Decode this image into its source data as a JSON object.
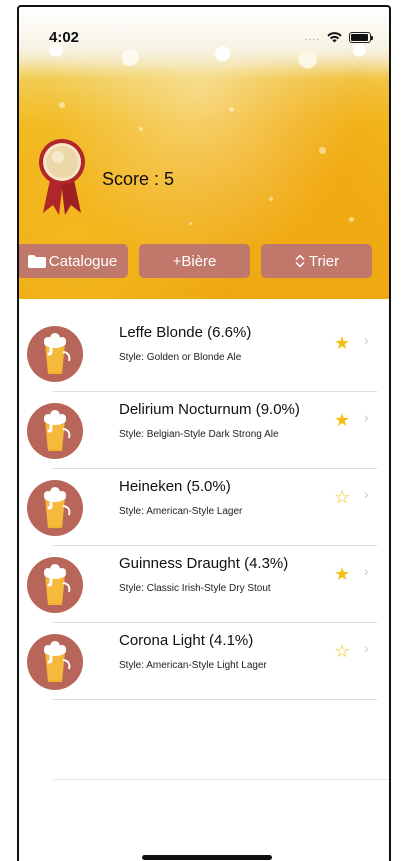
{
  "status_bar": {
    "time": "4:02",
    "signal_dots": "....",
    "wifi_icon": "wifi-icon",
    "battery_icon": "battery-icon"
  },
  "header": {
    "medal_icon": "medal-ribbon-icon",
    "score_text": "Score : 5"
  },
  "toolbar": {
    "catalogue_label": "Catalogue",
    "add_beer_label": "+Bière",
    "sort_label": "Trier"
  },
  "colors": {
    "button_bg": "#c0786a",
    "avatar_bg": "#b9665a",
    "star": "#f5bf12",
    "beer_amber": "#f0ae17"
  },
  "beers": [
    {
      "name": "Leffe Blonde (6.6%)",
      "style": "Style: Golden or Blonde Ale",
      "favorite": true
    },
    {
      "name": "Delirium Nocturnum (9.0%)",
      "style": "Style: Belgian-Style Dark Strong Ale",
      "favorite": true
    },
    {
      "name": "Heineken (5.0%)",
      "style": "Style: American-Style Lager",
      "favorite": false
    },
    {
      "name": "Guinness Draught (4.3%)",
      "style": "Style: Classic Irish-Style Dry Stout",
      "favorite": true
    },
    {
      "name": "Corona Light (4.1%)",
      "style": "Style: American-Style Light Lager",
      "favorite": false
    }
  ],
  "glyphs": {
    "star_filled": "★",
    "star_empty": "☆",
    "chevron": "›"
  }
}
